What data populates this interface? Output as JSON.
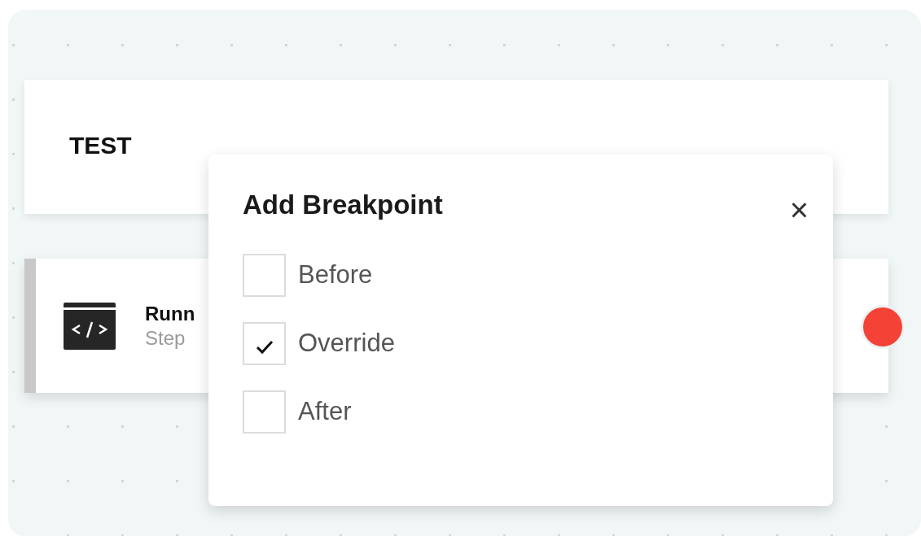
{
  "cards": [
    {
      "kind": "title",
      "title": "TEST"
    },
    {
      "kind": "step",
      "title": "Runn",
      "subtitle": "Step",
      "color": "#f44336"
    }
  ],
  "dialog": {
    "title": "Add Breakpoint",
    "close": "×",
    "options": [
      {
        "label": "Before",
        "checked": false
      },
      {
        "label": "Override",
        "checked": true
      },
      {
        "label": "After",
        "checked": false
      }
    ]
  }
}
